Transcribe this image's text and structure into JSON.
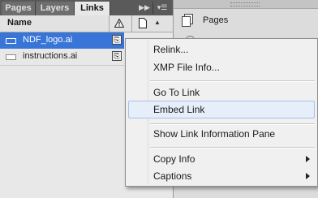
{
  "tabs": [
    {
      "label": "Pages",
      "active": false
    },
    {
      "label": "Layers",
      "active": false
    },
    {
      "label": "Links",
      "active": true
    }
  ],
  "panel_controls": {
    "collapse_icon": "double-chevron-right-icon",
    "menu_icon": "panel-menu-icon"
  },
  "columns": {
    "name": "Name",
    "status_icon": "warning-icon",
    "page_icon": "page-icon",
    "sort_icon": "sort-arrow-icon"
  },
  "links": [
    {
      "name": "NDF_logo.ai",
      "selected": true,
      "status_icon": "embedded-link-icon"
    },
    {
      "name": "instructions.ai",
      "selected": false,
      "status_icon": "embedded-link-icon"
    }
  ],
  "right_panel": {
    "pages_label": "Pages",
    "pages_icon": "pages-icon"
  },
  "context_menu": {
    "items": [
      {
        "label": "Relink..."
      },
      {
        "label": "XMP File Info..."
      },
      {
        "label": "Go To Link"
      },
      {
        "label": "Embed Link",
        "highlighted": true
      },
      {
        "label": "Show Link Information Pane"
      },
      {
        "label": "Copy Info",
        "submenu": true
      },
      {
        "label": "Captions",
        "submenu": true
      }
    ]
  },
  "colors": {
    "selection": "#3875d7",
    "menu_highlight": "#e6eef9",
    "tab_bar": "#5a5a5a"
  }
}
